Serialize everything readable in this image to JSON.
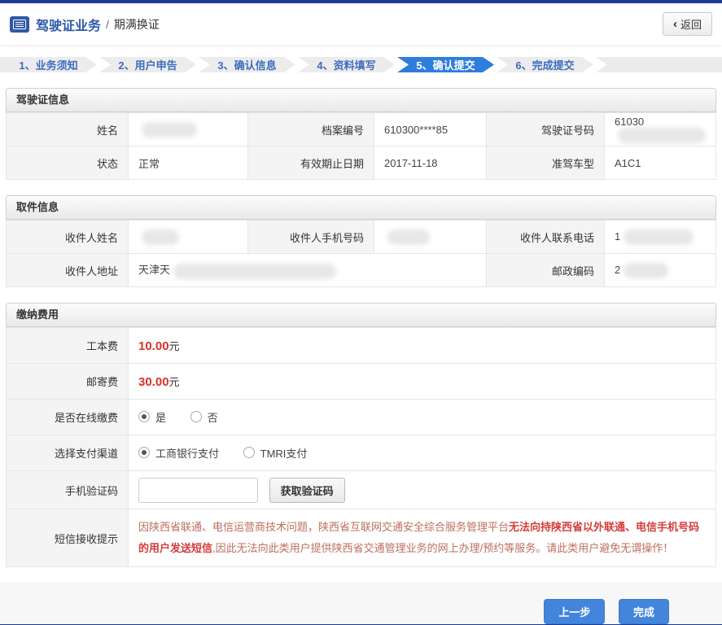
{
  "header": {
    "title": "驾驶证业务",
    "separator": "/",
    "subtitle": "期满换证",
    "back_chevron": "‹",
    "back_label": "返回"
  },
  "steps": {
    "items": [
      {
        "label": "1、业务须知",
        "active": false
      },
      {
        "label": "2、用户申告",
        "active": false
      },
      {
        "label": "3、确认信息",
        "active": false
      },
      {
        "label": "4、资料填写",
        "active": false
      },
      {
        "label": "5、确认提交",
        "active": true
      },
      {
        "label": "6、完成提交",
        "active": false
      }
    ]
  },
  "license": {
    "title": "驾驶证信息",
    "rows": [
      [
        {
          "label": "姓名",
          "value": ""
        },
        {
          "label": "档案编号",
          "value": "610300****85"
        },
        {
          "label": "驾驶证号码",
          "value": "61030"
        }
      ],
      [
        {
          "label": "状态",
          "value": "正常"
        },
        {
          "label": "有效期止日期",
          "value": "2017-11-18"
        },
        {
          "label": "准驾车型",
          "value": "A1C1"
        }
      ]
    ]
  },
  "pickup": {
    "title": "取件信息",
    "row0": [
      {
        "label": "收件人姓名",
        "value": ""
      },
      {
        "label": "收件人手机号码",
        "value": ""
      },
      {
        "label": "收件人联系电话",
        "value": "1"
      }
    ],
    "row1": {
      "address_label": "收件人地址",
      "address_value": "天津天",
      "zip_label": "邮政编码",
      "zip_value": "2"
    }
  },
  "fees": {
    "title": "缴纳费用",
    "cost": {
      "label": "工本费",
      "amount": "10.00",
      "unit": "元"
    },
    "postage": {
      "label": "邮寄费",
      "amount": "30.00",
      "unit": "元"
    },
    "online": {
      "label": "是否在线缴费",
      "options": [
        {
          "label": "是",
          "checked": true
        },
        {
          "label": "否",
          "checked": false
        }
      ]
    },
    "channel": {
      "label": "选择支付渠道",
      "options": [
        {
          "label": "工商银行支付",
          "checked": true
        },
        {
          "label": "TMRI支付",
          "checked": false
        }
      ]
    },
    "captcha": {
      "label": "手机验证码",
      "value": "",
      "button": "获取验证码"
    },
    "notice": {
      "label": "短信接收提示",
      "part1": "因陕西省联通、电信运营商技术问题，陕西省互联网交通安全综合服务管理平台",
      "part2": "无法向持陕西省以外联通、电信手机号码的用户发送短信",
      "part3": ",因此无法向此类用户提供陕西省交通管理业务的网上办理/预约等服务。请此类用户避免无谓操作！"
    }
  },
  "footer": {
    "prev_label": "上一步",
    "finish_label": "完成"
  }
}
